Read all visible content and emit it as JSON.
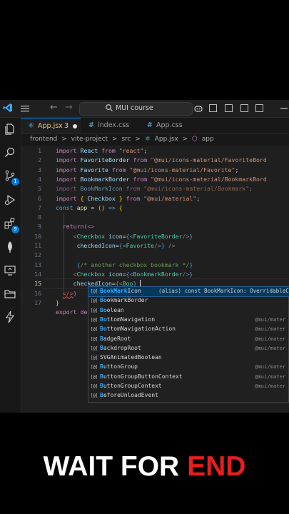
{
  "window": {
    "command_center": "MUI course"
  },
  "tabs": [
    {
      "label": "App.jsx",
      "badge": "3",
      "active": true,
      "icon": "react-icon"
    },
    {
      "label": "index.css",
      "active": false,
      "icon": "css-hash-icon"
    },
    {
      "label": "App.css",
      "active": false,
      "icon": "css-hash-icon"
    }
  ],
  "breadcrumb": [
    "frontend",
    ">",
    "vite-project",
    ">",
    "src",
    ">",
    "App.jsx",
    ">",
    "app"
  ],
  "activity_badges": {
    "source_control": "1",
    "extensions": "9"
  },
  "line_numbers": [
    "1",
    "2",
    "3",
    "4",
    "5",
    "6",
    "7",
    "8",
    "9",
    "10",
    "11",
    "12",
    "13",
    "14",
    "15",
    "16",
    "17"
  ],
  "suggestions": {
    "selected": {
      "match": "BookMark",
      "rest": "Icon",
      "info": "(alias) const BookMarkIcon: OverridableCo"
    },
    "items": [
      {
        "match": "Bo",
        "rest": "okmarkBorder",
        "detail": ""
      },
      {
        "match": "Bo",
        "rest": "olean",
        "detail": ""
      },
      {
        "match": "Bo",
        "rest": "ttomNavigation",
        "detail": "@mui/mater"
      },
      {
        "match": "Bo",
        "rest": "ttomNavigationAction",
        "detail": "@mui/mater"
      },
      {
        "match": "B",
        "rest": "adgeRoot",
        "detail": "@mui/mater"
      },
      {
        "match": "B",
        "rest": "ackdropRoot",
        "detail": "@mui/mater"
      },
      {
        "match": "SVGAnimatedBo",
        "rest": "olean",
        "detail": ""
      },
      {
        "match": "B",
        "rest": "uttonGroup",
        "detail": "@mui/mater"
      },
      {
        "match": "B",
        "rest": "uttonGroupButtonContext",
        "detail": "@mui/mater"
      },
      {
        "match": "B",
        "rest": "uttonGroupContext",
        "detail": "@mui/mater"
      },
      {
        "match": "B",
        "rest": "eforeUnloadEvent",
        "detail": ""
      }
    ]
  },
  "caption": {
    "white": "WAIT FOR ",
    "red": "END"
  },
  "colors": {
    "accent": "#0078d4",
    "caption_red": "#e61e1e",
    "selection": "#04395e"
  }
}
